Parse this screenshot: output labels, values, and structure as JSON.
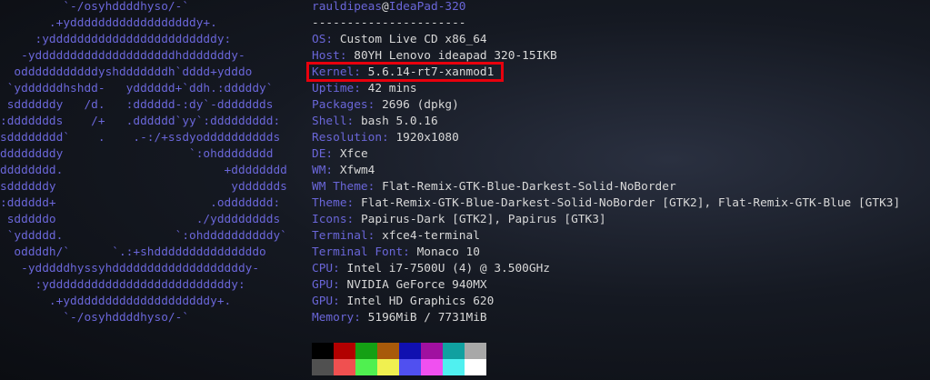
{
  "ascii_logo": [
    "         `-/osyhddddhyso/-`",
    "       .+yddddddddddddddddddy+.",
    "     :yddddddddddddddddddddddddy:",
    "   -yddddddddddddddddddddhdddddddy-",
    "  odddddddddddyshdddddddh`dddd+ydddo",
    " `yddddddhshdd-   ydddddd+`ddh.:dddddy`",
    " sddddddy   /d.   :dddddd-:dy`-ddddddds",
    ":ddddddds    /+   .dddddd`yy`:ddddddddd:",
    "sdddddddd`    .    .-:/+ssdyodddddddddds",
    "ddddddddy                  `:ohdddddddd",
    "dddddddd.                       +dddddddd",
    "sddddddy                         ydddddds",
    ":dddddd+                      .oddddddd:",
    " sdddddo                    ./ydddddddds",
    " `yddddd.                `:ohddddddddddy`",
    "  oddddh/`      `.:+shdddddddddddddddo",
    "   -ydddddhyssyhdddddddddddddddddddy-",
    "     :yddddddddddddddddddddddddddy:",
    "       .+yddddddddddddddddddddy+.",
    "         `-/osyhddddhyso/-`"
  ],
  "userhost": {
    "user": "rauldipeas",
    "at": "@",
    "host": "IdeaPad-320"
  },
  "separator": "----------------------",
  "info": {
    "os": {
      "key": "OS",
      "value": "Custom Live CD x86_64"
    },
    "host": {
      "key": "Host",
      "value": "80YH Lenovo ideapad 320-15IKB"
    },
    "kernel": {
      "key": "Kernel",
      "value": "5.6.14-rt7-xanmod1"
    },
    "uptime": {
      "key": "Uptime",
      "value": "42 mins"
    },
    "packages": {
      "key": "Packages",
      "value": "2696 (dpkg)"
    },
    "shell": {
      "key": "Shell",
      "value": "bash 5.0.16"
    },
    "resolution": {
      "key": "Resolution",
      "value": "1920x1080"
    },
    "de": {
      "key": "DE",
      "value": "Xfce"
    },
    "wm": {
      "key": "WM",
      "value": "Xfwm4"
    },
    "wm_theme": {
      "key": "WM Theme",
      "value": "Flat-Remix-GTK-Blue-Darkest-Solid-NoBorder"
    },
    "theme": {
      "key": "Theme",
      "value": "Flat-Remix-GTK-Blue-Darkest-Solid-NoBorder [GTK2], Flat-Remix-GTK-Blue [GTK3]"
    },
    "icons": {
      "key": "Icons",
      "value": "Papirus-Dark [GTK2], Papirus [GTK3]"
    },
    "terminal": {
      "key": "Terminal",
      "value": "xfce4-terminal"
    },
    "terminal_font": {
      "key": "Terminal Font",
      "value": "Monaco 10"
    },
    "cpu": {
      "key": "CPU",
      "value": "Intel i7-7500U (4) @ 3.500GHz"
    },
    "gpu1": {
      "key": "GPU",
      "value": "NVIDIA GeForce 940MX"
    },
    "gpu2": {
      "key": "GPU",
      "value": "Intel HD Graphics 620"
    },
    "memory": {
      "key": "Memory",
      "value": "5196MiB / 7731MiB"
    }
  },
  "colors": {
    "accent": "#6a66d8",
    "text": "#d8d8d8",
    "highlight_box": "#e8000d",
    "palette_normal": [
      "#000000",
      "#b20000",
      "#14a014",
      "#a85a0a",
      "#1010b0",
      "#a010a0",
      "#10a0a0",
      "#a8a8a8"
    ],
    "palette_bright": [
      "#505050",
      "#f05050",
      "#50f050",
      "#f0f050",
      "#5050f0",
      "#f050f0",
      "#50f0f0",
      "#ffffff"
    ]
  }
}
